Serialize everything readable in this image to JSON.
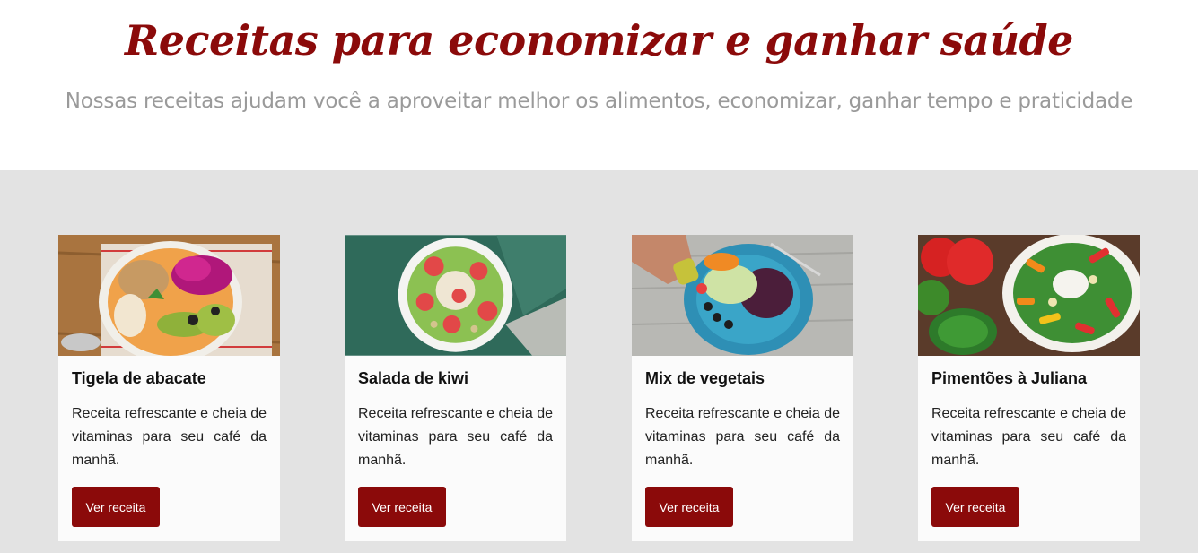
{
  "hero": {
    "title": "Receitas para economizar e ganhar saúde",
    "subtitle": "Nossas receitas ajudam você a aproveitar melhor os alimentos, economizar, ganhar tempo e praticidade"
  },
  "cards": [
    {
      "title": "Tigela de abacate",
      "text": "Receita refrescante e cheia de vitaminas para seu café da manhã.",
      "button": "Ver receita"
    },
    {
      "title": "Salada de kiwi",
      "text": "Receita refrescante e cheia de vitaminas para seu café da manhã.",
      "button": "Ver receita"
    },
    {
      "title": "Mix de vegetais",
      "text": "Receita refrescante e cheia de vitaminas para seu café da manhã.",
      "button": "Ver receita"
    },
    {
      "title": "Pimentões à Juliana",
      "text": "Receita refrescante e cheia de vitaminas para seu café da manhã.",
      "button": "Ver receita"
    }
  ],
  "colors": {
    "brand": "#8b0a0a",
    "section_bg": "#e3e3e3",
    "subtitle": "#9a9a9a"
  }
}
